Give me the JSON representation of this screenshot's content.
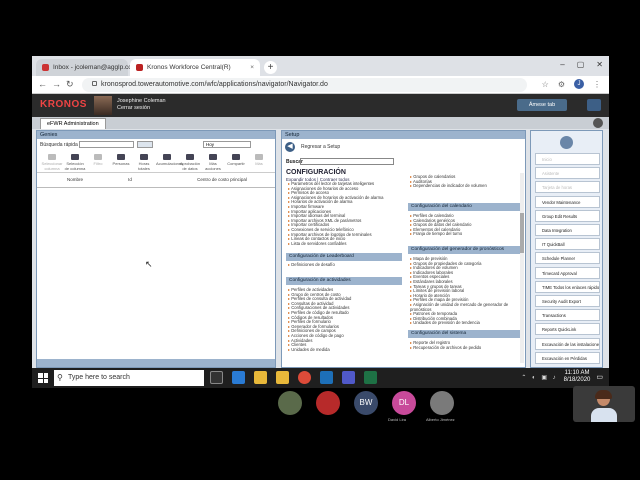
{
  "browser": {
    "tabs": [
      {
        "label": "Inbox - jcoleman@agglp.com",
        "active": false
      },
      {
        "label": "Kronos Workforce Central(R)",
        "active": true
      }
    ],
    "url": "kronosprod.towerautomotive.com/wfc/applications/navigator/Navigator.do",
    "profile_initial": "J"
  },
  "kronos": {
    "logo": "KRONOS",
    "user_name": "Josephine Coleman",
    "user_sub": "Cerrar sesión",
    "goto_label": "Ámese tab",
    "workspace_tab": "eFWR Administration"
  },
  "genies": {
    "title": "Genies",
    "search_label": "Búsqueda rápida",
    "date_value": "Hoy",
    "toolbar": [
      {
        "label": "Seleccionar columna",
        "enabled": false
      },
      {
        "label": "Selección de columna",
        "enabled": true
      },
      {
        "label": "Filtro",
        "enabled": false
      },
      {
        "label": "Personas",
        "enabled": true
      },
      {
        "label": "Horas totales",
        "enabled": true
      },
      {
        "label": "Acumulaciones",
        "enabled": true
      },
      {
        "label": "Aprobación de datos",
        "enabled": true
      },
      {
        "label": "Más acciones",
        "enabled": true
      },
      {
        "label": "Compartir",
        "enabled": true
      },
      {
        "label": "Más",
        "enabled": false
      }
    ],
    "columns": [
      "Nombre",
      "Id",
      "Centro de costo principal"
    ]
  },
  "setup": {
    "title": "Setup",
    "back_label": "Regresar a Setup",
    "search_label": "Buscar",
    "config_title": "CONFIGURACIÓN",
    "expand_label": "Expandir todos | Contraer todos",
    "left_list": [
      "Parámetros del lector de tarjetas inteligentes",
      "Asignaciones de horarios de acceso",
      "Permisos de acceso",
      "Asignaciones de horarios de activación de alarma",
      "Horarios de activación de alarma",
      "Importar firmware",
      "Importar aplicaciones",
      "Importar idiomas del terminal",
      "Importar archivos XML de parámetros",
      "Importar certificados",
      "Conexiones de servicio telefónico",
      "Importar archivos de logotipo de terminales",
      "Líneas de contactos de inicio",
      "Lista de servidores confiables"
    ],
    "leaderboard_header": "Configuración de Leaderboard",
    "leaderboard_items": [
      "Definiciones de desafío"
    ],
    "activities_header": "Configuración de actividades",
    "activities_items": [
      "Perfiles de actividades",
      "Grupo de centros de costo",
      "Perfiles de consulta de actividad",
      "Consultas de actividad",
      "Configuraciones de actividades",
      "Perfiles de código de resultado",
      "Códigos de resultados",
      "Perfiles de formulario",
      "Generador de formularios",
      "Definiciones de campos",
      "Acciones de código de pago",
      "Actividades",
      "Clientes",
      "Unidades de medida"
    ],
    "right_top_items": [
      "Grupos de calendarios",
      "Auditorías",
      "Dependencias de indicador de volumen"
    ],
    "calendar_header": "Configuración del calendario",
    "calendar_items": [
      "Perfiles de calendario",
      "Calendarios genéricos",
      "Grupos de datos del calendario",
      "Elementos del calendario",
      "Franja de tiempo del turno"
    ],
    "forecast_header": "Configuración del generador de pronósticos",
    "forecast_items": [
      "Mapa de previsión",
      "Grupos de propiedades de categoría",
      "Indicadores de volumen",
      "Indicadores laborales",
      "Eventos especiales",
      "Estándares laborales",
      "Tareas y grupos de tareas",
      "Límites de previsión laboral",
      "Horario de atención",
      "Perfiles de mapa de previsión",
      "Asignación de unidad de mercado de generador de pronósticos",
      "Patrones de temporada",
      "Distribución combinada",
      "Unidades de previsión de tendencia"
    ],
    "system_header": "Configuración del sistema",
    "system_items": [
      "Reporte del registro",
      "Recuperación de archivos de pedido"
    ]
  },
  "related_items": [
    {
      "label": "Inicio",
      "faded": true
    },
    {
      "label": "Asistente",
      "faded": true
    },
    {
      "label": "Tarjeta de horas",
      "faded": true
    },
    {
      "label": "Vendor Maintenance",
      "faded": false
    },
    {
      "label": "Group Edit Results",
      "faded": false
    },
    {
      "label": "Data Integration",
      "faded": false
    },
    {
      "label": "IT QuickBall",
      "faded": false
    },
    {
      "label": "Schedule Planner",
      "faded": false
    },
    {
      "label": "Timecard Approval",
      "faded": false
    },
    {
      "label": "TIME Todos los enlaces rápidos",
      "faded": false
    },
    {
      "label": "Security Audit Export",
      "faded": false
    },
    {
      "label": "Transactions",
      "faded": false
    },
    {
      "label": "Reports QuickLink",
      "faded": false
    },
    {
      "label": "Excavación de las instalaciones",
      "faded": false
    },
    {
      "label": "Excavación en Pérdidas",
      "faded": false
    }
  ],
  "taskbar": {
    "search_placeholder": "Type here to search",
    "time": "11:10 AM",
    "date": "8/18/2020"
  },
  "call": {
    "participants": [
      {
        "initials": "",
        "name": "",
        "color": "#5a6a4a"
      },
      {
        "initials": "",
        "name": "",
        "color": "#b72a2a"
      },
      {
        "initials": "BW",
        "name": "",
        "color": "#3a4a6a"
      },
      {
        "initials": "DL",
        "name": "David Lira",
        "color": "#c84a9a"
      },
      {
        "initials": "",
        "name": "Alberto Jiménez",
        "color": "#7a7a7a"
      }
    ]
  }
}
